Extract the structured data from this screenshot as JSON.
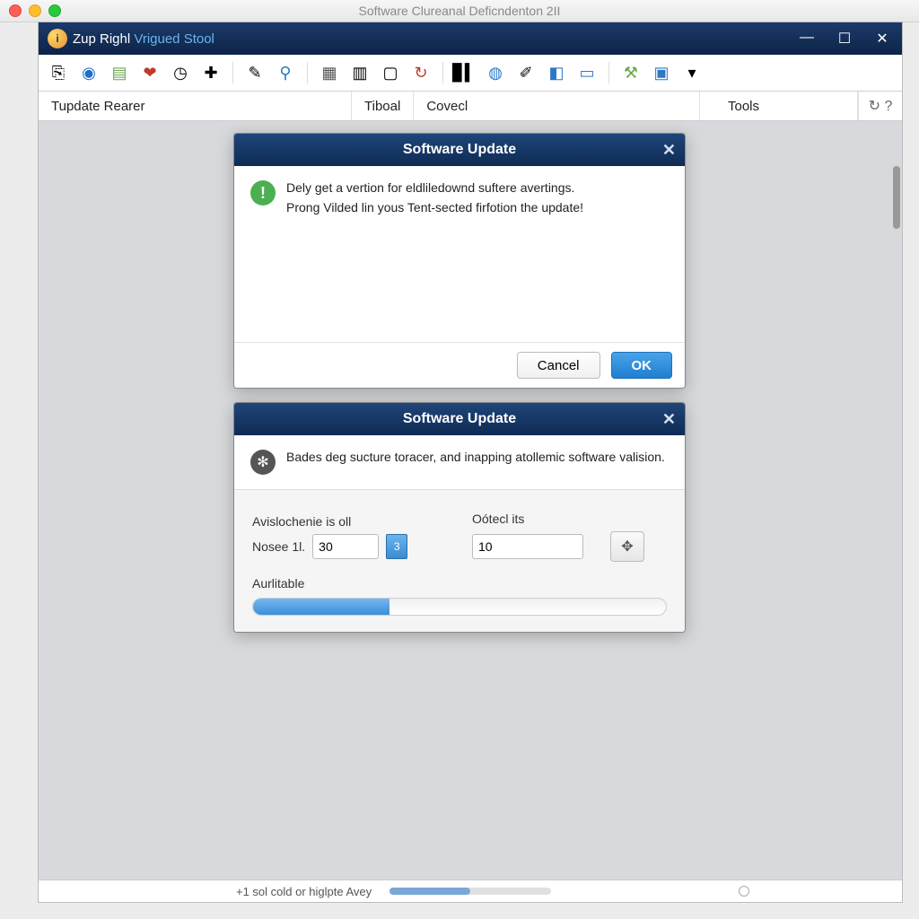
{
  "mac_title": "Software Clureanal Deficndenton 2II",
  "app_title_1": "Zup Righl",
  "app_title_2": "Vrigued Stool",
  "menubar": {
    "m1": "Tupdate Rearer",
    "m2": "Tiboal",
    "m3": "Covecl",
    "m4": "Tools"
  },
  "dialog1": {
    "title": "Software Update",
    "line1": "Dely get a vertion for eldliledownd suftere avertings.",
    "line2": "Prong Vilded lin yous Tent-sected firfotion the update!",
    "cancel": "Cancel",
    "ok": "OK"
  },
  "dialog2": {
    "title": "Software Update",
    "body": "Bades deg sucture toracer, and inapping atollemic software valision.",
    "group1_label": "Avislochenie is oll",
    "group2_label": "Oótecl its",
    "field1_label": "Nosee 1l.",
    "field1_value": "30",
    "stepper_label": "3",
    "field2_value": "10",
    "progress_label": "Aurlitable",
    "progress_pct": 33
  },
  "status": {
    "text": "+1 sol cold or higlpte Avey"
  },
  "colors": {
    "header_blue": "#123a6d",
    "accent_blue": "#3d8fd8"
  }
}
